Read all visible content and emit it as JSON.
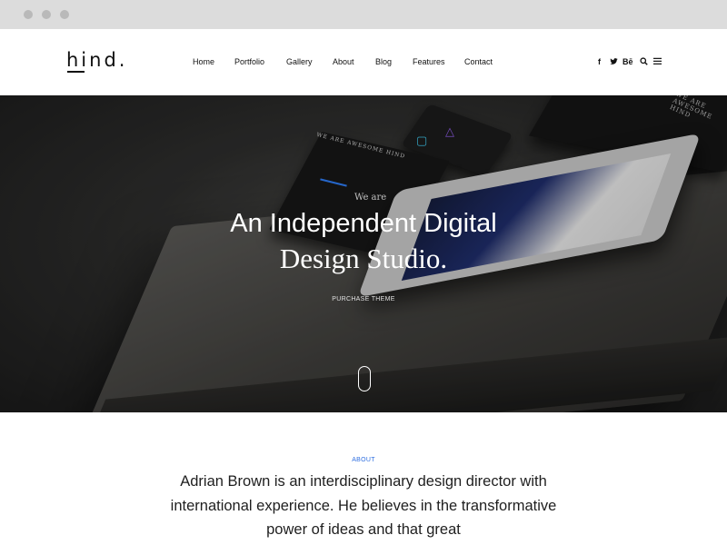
{
  "browser": {
    "dots": 3
  },
  "header": {
    "logo": "hind.",
    "nav": [
      {
        "label": "Home"
      },
      {
        "label": "Portfolio"
      },
      {
        "label": "Gallery"
      },
      {
        "label": "About"
      },
      {
        "label": "Blog"
      },
      {
        "label": "Features"
      },
      {
        "label": "Contact"
      }
    ],
    "social": [
      {
        "label": "f",
        "icon": "facebook-icon"
      },
      {
        "label": "’",
        "icon": "twitter-icon"
      },
      {
        "label": "Bē",
        "icon": "behance-icon"
      },
      {
        "label": "⌕",
        "icon": "search-icon"
      },
      {
        "label": "≡",
        "icon": "menu-icon"
      }
    ]
  },
  "hero": {
    "title_line1": "An Independent Digital",
    "title_line2": "Design Studio.",
    "cta": "PURCHASE THEME",
    "mockup": {
      "book_text": "WE ARE AWESOME HIND",
      "book_caption": "We are",
      "envelope_text": "WE ARE AWESOME HIND"
    }
  },
  "about": {
    "label": "ABOUT",
    "text": "Adrian Brown is an interdisciplinary design director with international experience. He believes in the transformative power of ideas and that great"
  },
  "colors": {
    "accent": "#2f6fe0",
    "hero_bg": "#2e2e2d",
    "text": "#1f1f1f"
  }
}
